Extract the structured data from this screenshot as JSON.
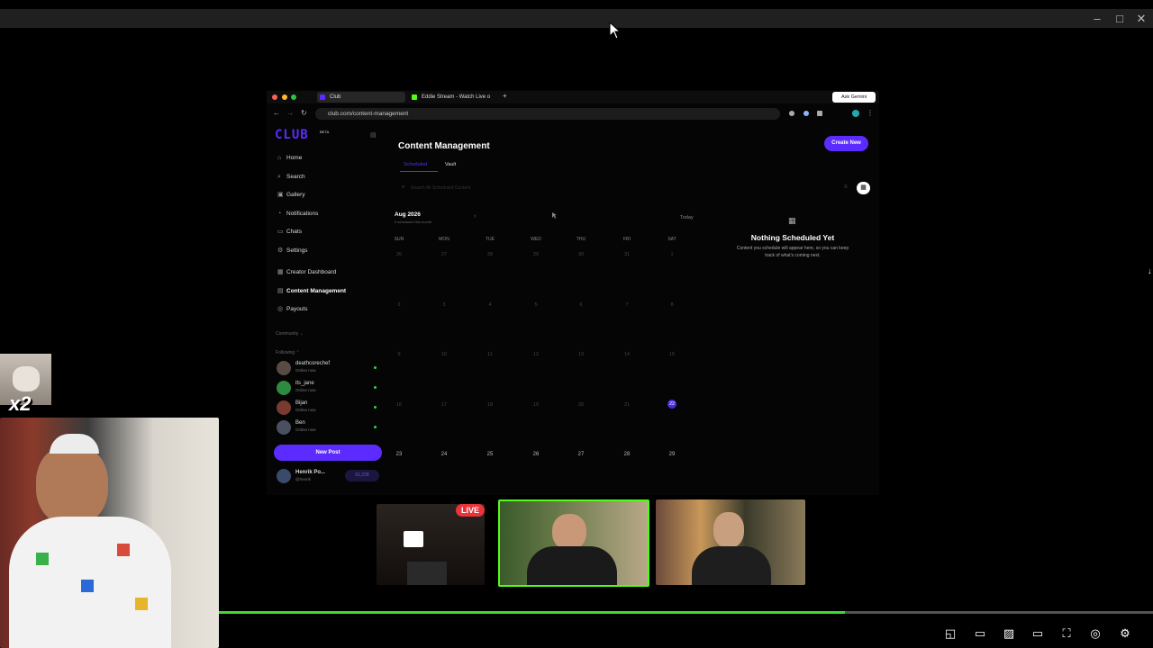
{
  "window": {
    "minimize_icon": "–",
    "maximize_icon": "□",
    "close_icon": "✕"
  },
  "browser": {
    "tabs": [
      {
        "label": "Club"
      },
      {
        "label": "Eddie Stream - Watch Live o"
      }
    ],
    "new_tab": "+",
    "url": "club.com/content-management",
    "ask_gemini": "Ask Gemini"
  },
  "app": {
    "logo": "CLUB",
    "logo_badge": "BETA",
    "nav": [
      {
        "label": "Home",
        "icon": "⌂"
      },
      {
        "label": "Search",
        "icon": "⌕"
      },
      {
        "label": "Gallery",
        "icon": "▣"
      },
      {
        "label": "Notifications",
        "icon": "◔"
      },
      {
        "label": "Chats",
        "icon": "▭"
      },
      {
        "label": "Settings",
        "icon": "⚙"
      },
      {
        "label": "Creator Dashboard",
        "icon": "▦"
      },
      {
        "label": "Content Management",
        "icon": "▤"
      },
      {
        "label": "Payouts",
        "icon": "◎"
      }
    ],
    "community_label": "Community",
    "following_label": "Following",
    "following": [
      {
        "name": "deathcorechef",
        "status": "Online now"
      },
      {
        "name": "its_jane",
        "status": "Online now"
      },
      {
        "name": "Bijan",
        "status": "Online now"
      },
      {
        "name": "Ben",
        "status": "Online now"
      }
    ],
    "new_post": "New Post",
    "profile": {
      "name": "Henrik Po...",
      "handle": "@henrik",
      "balance": "51,228"
    },
    "page_title": "Content Management",
    "tabs": [
      {
        "label": "Scheduled"
      },
      {
        "label": "Vault"
      }
    ],
    "search_placeholder": "Search All Scheduled Content",
    "create_new": "Create New",
    "calendar": {
      "month": "Aug 2026",
      "sub": "0 scheduled this month",
      "today": "Today",
      "days_of_week": [
        "SUN",
        "MON",
        "TUE",
        "WED",
        "THU",
        "FRI",
        "SAT"
      ],
      "weeks": [
        [
          "26",
          "27",
          "28",
          "29",
          "30",
          "31",
          "1"
        ],
        [
          "2",
          "3",
          "4",
          "5",
          "6",
          "7",
          "8"
        ],
        [
          "9",
          "10",
          "11",
          "12",
          "13",
          "14",
          "15"
        ],
        [
          "16",
          "17",
          "18",
          "19",
          "20",
          "21",
          "22"
        ],
        [
          "23",
          "24",
          "25",
          "26",
          "27",
          "28",
          "29"
        ]
      ],
      "today_date": "22"
    },
    "empty": {
      "title": "Nothing Scheduled Yet",
      "body_line1": "Content you schedule will appear here, so you can keep",
      "body_line2": "track of what's coming next."
    }
  },
  "overlay": {
    "live_badge": "LIVE",
    "multiplier": "x2"
  },
  "player": {
    "progress_fraction": 0.67,
    "progress_color": "#3ddc2f"
  },
  "colors": {
    "accent": "#5b2bff",
    "today_highlight": "#4a2be0"
  }
}
